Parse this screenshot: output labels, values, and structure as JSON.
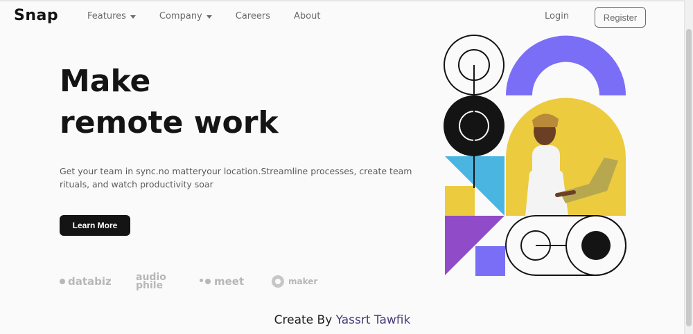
{
  "brand": {
    "name": "Snap"
  },
  "nav": {
    "items": [
      {
        "label": "Features",
        "has_dropdown": true
      },
      {
        "label": "Company",
        "has_dropdown": true
      },
      {
        "label": "Careers",
        "has_dropdown": false
      },
      {
        "label": "About",
        "has_dropdown": false
      }
    ],
    "login_label": "Login",
    "register_label": "Register"
  },
  "hero": {
    "title_line1": "Make",
    "title_line2": "remote work",
    "description": "Get your team in sync.no matteryour location.Streamline processes, create team rituals, and watch productivity soar",
    "cta_label": "Learn More"
  },
  "clients": {
    "databiz": "databiz",
    "audiophile_line1": "audio",
    "audiophile_line2": "phile",
    "meet": "meet",
    "maker": "maker"
  },
  "footer": {
    "prefix": "Create By",
    "author": "Yassrt Tawfik"
  },
  "colors": {
    "accent_purple": "#7b6ef6",
    "accent_yellow": "#eccb3f",
    "accent_blue": "#4bb5e2",
    "accent_violet": "#8f4bc8",
    "dark": "#141414"
  },
  "icons": {
    "dropdown": "chevron-down-icon"
  }
}
